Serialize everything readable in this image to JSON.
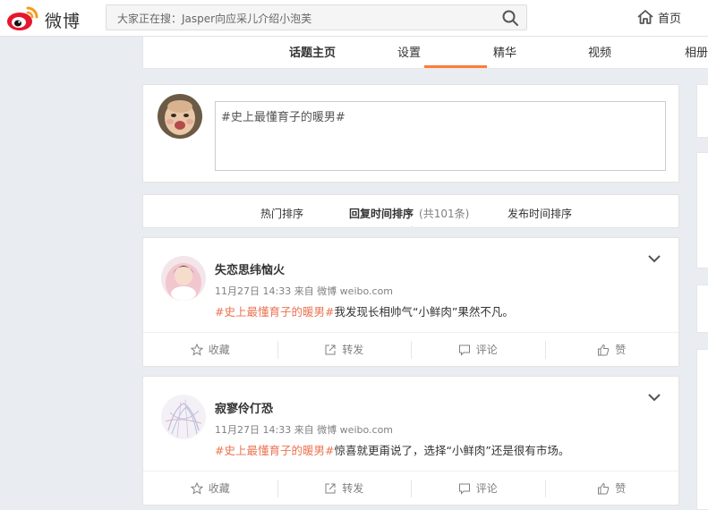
{
  "header": {
    "logo_text": "微博",
    "search_placeholder": "大家正在搜：Jasper向应采儿介绍小泡芙",
    "home_label": "首页"
  },
  "nav": {
    "tabs": [
      {
        "label": "话题主页",
        "active": true
      },
      {
        "label": "设置"
      },
      {
        "label": "精华"
      },
      {
        "label": "视频"
      },
      {
        "label": "相册"
      }
    ]
  },
  "compose": {
    "text": "#史上最懂育子的暖男#"
  },
  "sort": {
    "hot": "热门排序",
    "reply_time": "回复时间排序",
    "count": "(共101条)",
    "post_time": "发布时间排序"
  },
  "posts": [
    {
      "name": "失恋思纬恼火",
      "meta": "11月27日 14:33 来自 微博 weibo.com",
      "hashtag": "#史上最懂育子的暖男#",
      "text": "我发现长相帅气“小鲜肉”果然不凡。",
      "actions": [
        "收藏",
        "转发",
        "评论",
        "赞"
      ]
    },
    {
      "name": "寂寥伶仃恐",
      "meta": "11月27日 14:33 来自 微博 weibo.com",
      "hashtag": "#史上最懂育子的暖男#",
      "text": "惊喜就更甭说了，选择“小鲜肉”还是很有市场。",
      "actions": [
        "收藏",
        "转发",
        "评论",
        "赞"
      ]
    }
  ],
  "colors": {
    "accent": "#fa7d3c",
    "hashtag": "#eb7350",
    "page_bg": "#e9ecf1"
  }
}
